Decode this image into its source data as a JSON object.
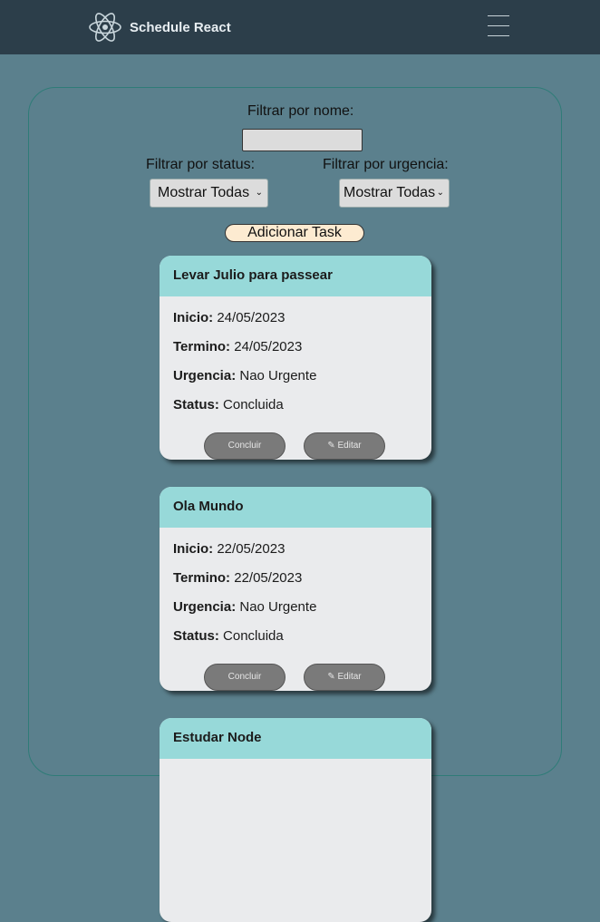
{
  "navbar": {
    "brand": "Schedule React",
    "logo_icon": "react-atom-icon",
    "menu_icon": "hamburger-icon"
  },
  "filters": {
    "name_label": "Filtrar por nome:",
    "name_value": "",
    "status_label": "Filtrar por status:",
    "status_selected": "Mostrar Todas",
    "urgency_label": "Filtrar por urgencia:",
    "urgency_selected": "Mostrar Todas"
  },
  "add_button": "Adicionar Task",
  "field_labels": {
    "inicio": "Inicio:",
    "termino": "Termino:",
    "urgencia": "Urgencia:",
    "status": "Status:"
  },
  "actions": {
    "concluir": "Concluir",
    "editar": "Editar",
    "edit_icon": "pencil-icon"
  },
  "tasks": [
    {
      "title": "Levar Julio para passear",
      "inicio": "24/05/2023",
      "termino": "24/05/2023",
      "urgencia": "Nao Urgente",
      "status": "Concluida"
    },
    {
      "title": "Ola Mundo",
      "inicio": "22/05/2023",
      "termino": "22/05/2023",
      "urgencia": "Nao Urgente",
      "status": "Concluida"
    },
    {
      "title": "Estudar Node"
    }
  ],
  "colors": {
    "navbar": "#2c3e4a",
    "background": "#5b808d",
    "card_header": "#97d9d9",
    "card_body": "#eaebed",
    "add_button": "#fdebd1"
  }
}
